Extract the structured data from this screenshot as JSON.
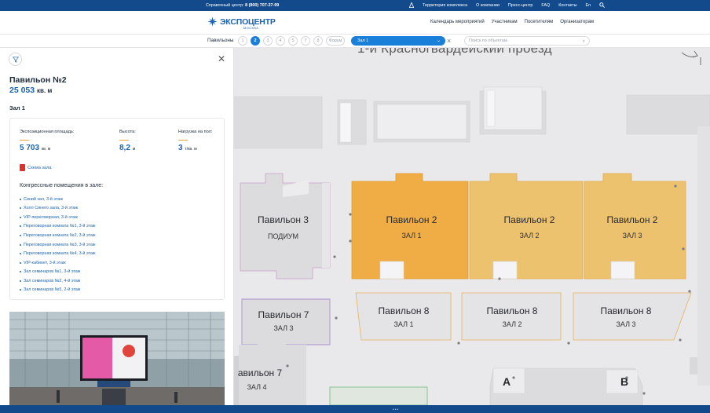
{
  "topbar": {
    "phone_label": "Справочный центр:",
    "phone_number": "8 (800) 707-37-99",
    "links": [
      "Территория комплекса",
      "О компании",
      "Пресс-центр",
      "FAQ",
      "Контакты",
      "En"
    ]
  },
  "header": {
    "logo_text": "ЭКСПОЦЕНТР",
    "logo_sub": "МОСКВА",
    "nav": [
      "Календарь мероприятий",
      "Участникам",
      "Посетителям",
      "Организаторам"
    ]
  },
  "selector": {
    "label": "Павильоны",
    "pills": [
      "1",
      "2",
      "3",
      "4",
      "5",
      "7",
      "8",
      "Форум"
    ],
    "active_pill": "2",
    "hall_value": "Зал 1",
    "search_placeholder": "Поиск по объектам"
  },
  "panel": {
    "title": "Павильон №2",
    "area_value": "25 053",
    "area_unit": "кв. м",
    "hall": "Зал 1",
    "stats": [
      {
        "label": "Экспозиционная площадь:",
        "value": "5 703",
        "unit": "кв. м"
      },
      {
        "label": "Высота:",
        "value": "8,2",
        "unit": "м"
      },
      {
        "label": "Нагрузка на пол:",
        "value": "3",
        "unit": "т/кв. м"
      }
    ],
    "scheme_link": "Схема зала",
    "rooms_title": "Конгрессные помещения в зале:",
    "rooms": [
      "Синий зал, 3-й этаж",
      "Холл Синего зала, 3-й этаж",
      "VIP-переговорная, 3-й этаж",
      "Переговорная комната №1, 3-й этаж",
      "Переговорная комната №2, 3-й этаж",
      "Переговорная комната №3, 3-й этаж",
      "Переговорная комната №4, 3-й этаж",
      "VIP-кабинет, 3-й этаж",
      "Зал семинаров №1, 3-й этаж",
      "Зал семинаров №2, 4-й этаж",
      "Зал семинаров №5, 2-й этаж"
    ]
  },
  "map": {
    "street": "1-й Красногвардейский проезд",
    "halls": [
      {
        "name": "Павильон 3",
        "sub": "ПОДИУМ"
      },
      {
        "name": "Павильон 2",
        "sub": "ЗАЛ 1"
      },
      {
        "name": "Павильон 2",
        "sub": "ЗАЛ 2"
      },
      {
        "name": "Павильон 2",
        "sub": "ЗАЛ 3"
      },
      {
        "name": "Павильон 7",
        "sub": "ЗАЛ 3"
      },
      {
        "name": "Павильон 8",
        "sub": "ЗАЛ 1"
      },
      {
        "name": "Павильон 8",
        "sub": "ЗАЛ 2"
      },
      {
        "name": "Павильон 8",
        "sub": "ЗАЛ 3"
      },
      {
        "name": "авильон 7",
        "sub": "ЗАЛ 4"
      }
    ],
    "zones": [
      "A",
      "B"
    ],
    "colors": {
      "selected": "#f0ad45",
      "hall2_other": "#edc26e",
      "pav8": "#e4e4e6",
      "pav8_border": "#e8b25a",
      "pav7_border": "#a990d0"
    }
  }
}
